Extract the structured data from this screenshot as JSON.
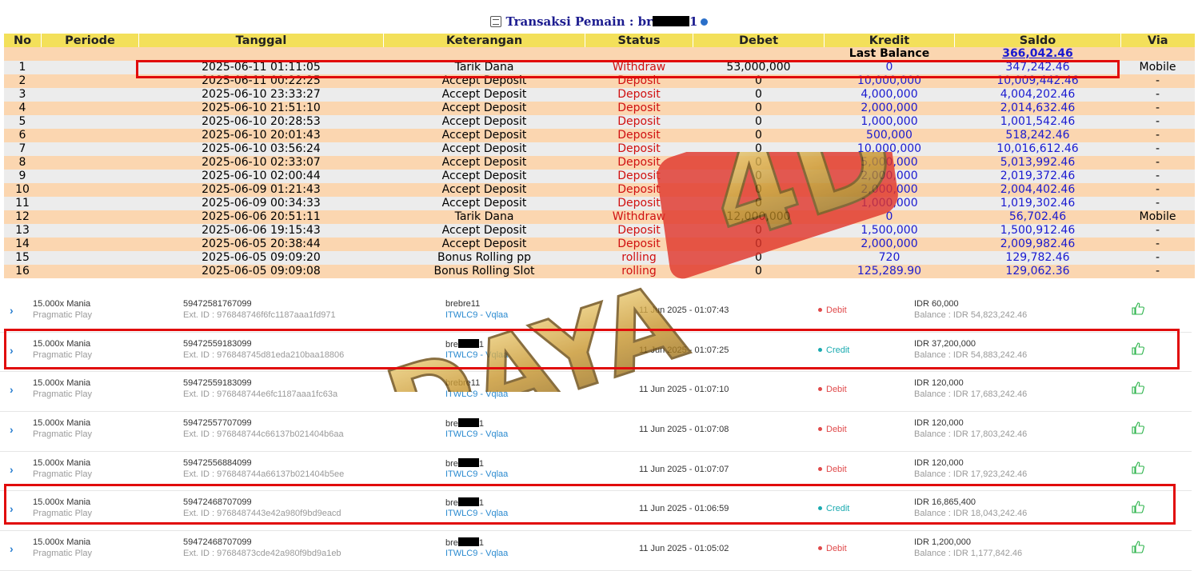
{
  "header": {
    "title_prefix": "Transaksi  Pemain : br",
    "title_suffix": "1"
  },
  "columns": [
    "No",
    "Periode",
    "Tanggal",
    "Keterangan",
    "Status",
    "Debet",
    "Kredit",
    "Saldo",
    "Via"
  ],
  "last_balance": {
    "label": "Last Balance",
    "value": "366,042.46"
  },
  "transactions": [
    {
      "no": "1",
      "tanggal": "2025-06-11 01:11:05",
      "ket": "Tarik Dana",
      "status": "Withdraw",
      "debet": "53,000,000",
      "kredit": "0",
      "saldo": "347,242.46",
      "via": "Mobile"
    },
    {
      "no": "2",
      "tanggal": "2025-06-11 00:22:25",
      "ket": "Accept Deposit",
      "status": "Deposit",
      "debet": "0",
      "kredit": "10,000,000",
      "saldo": "10,009,442.46",
      "via": "-"
    },
    {
      "no": "3",
      "tanggal": "2025-06-10 23:33:27",
      "ket": "Accept Deposit",
      "status": "Deposit",
      "debet": "0",
      "kredit": "4,000,000",
      "saldo": "4,004,202.46",
      "via": "-"
    },
    {
      "no": "4",
      "tanggal": "2025-06-10 21:51:10",
      "ket": "Accept Deposit",
      "status": "Deposit",
      "debet": "0",
      "kredit": "2,000,000",
      "saldo": "2,014,632.46",
      "via": "-"
    },
    {
      "no": "5",
      "tanggal": "2025-06-10 20:28:53",
      "ket": "Accept Deposit",
      "status": "Deposit",
      "debet": "0",
      "kredit": "1,000,000",
      "saldo": "1,001,542.46",
      "via": "-"
    },
    {
      "no": "6",
      "tanggal": "2025-06-10 20:01:43",
      "ket": "Accept Deposit",
      "status": "Deposit",
      "debet": "0",
      "kredit": "500,000",
      "saldo": "518,242.46",
      "via": "-"
    },
    {
      "no": "7",
      "tanggal": "2025-06-10 03:56:24",
      "ket": "Accept Deposit",
      "status": "Deposit",
      "debet": "0",
      "kredit": "10,000,000",
      "saldo": "10,016,612.46",
      "via": "-"
    },
    {
      "no": "8",
      "tanggal": "2025-06-10 02:33:07",
      "ket": "Accept Deposit",
      "status": "Deposit",
      "debet": "0",
      "kredit": "5,000,000",
      "saldo": "5,013,992.46",
      "via": "-"
    },
    {
      "no": "9",
      "tanggal": "2025-06-10 02:00:44",
      "ket": "Accept Deposit",
      "status": "Deposit",
      "debet": "0",
      "kredit": "2,000,000",
      "saldo": "2,019,372.46",
      "via": "-"
    },
    {
      "no": "10",
      "tanggal": "2025-06-09 01:21:43",
      "ket": "Accept Deposit",
      "status": "Deposit",
      "debet": "0",
      "kredit": "2,000,000",
      "saldo": "2,004,402.46",
      "via": "-"
    },
    {
      "no": "11",
      "tanggal": "2025-06-09 00:34:33",
      "ket": "Accept Deposit",
      "status": "Deposit",
      "debet": "0",
      "kredit": "1,000,000",
      "saldo": "1,019,302.46",
      "via": "-"
    },
    {
      "no": "12",
      "tanggal": "2025-06-06 20:51:11",
      "ket": "Tarik Dana",
      "status": "Withdraw",
      "debet": "12,000,000",
      "kredit": "0",
      "saldo": "56,702.46",
      "via": "Mobile"
    },
    {
      "no": "13",
      "tanggal": "2025-06-06 19:15:43",
      "ket": "Accept Deposit",
      "status": "Deposit",
      "debet": "0",
      "kredit": "1,500,000",
      "saldo": "1,500,912.46",
      "via": "-"
    },
    {
      "no": "14",
      "tanggal": "2025-06-05 20:38:44",
      "ket": "Accept Deposit",
      "status": "Deposit",
      "debet": "0",
      "kredit": "2,000,000",
      "saldo": "2,009,982.46",
      "via": "-"
    },
    {
      "no": "15",
      "tanggal": "2025-06-05 09:09:20",
      "ket": "Bonus Rolling pp",
      "status": "rolling",
      "debet": "0",
      "kredit": "720",
      "saldo": "129,782.46",
      "via": "-"
    },
    {
      "no": "16",
      "tanggal": "2025-06-05 09:09:08",
      "ket": "Bonus Rolling Slot",
      "status": "rolling",
      "debet": "0",
      "kredit": "125,289.90",
      "saldo": "129,062.36",
      "via": "-"
    }
  ],
  "bets": [
    {
      "game": "15.000x Mania",
      "provider": "Pragmatic Play",
      "id": "59472581767099",
      "ext": "Ext. ID : 976848746f6fc1187aaa1fd971",
      "user": "brebre11",
      "user_redacted": false,
      "site": "ITWLC9 - Vqlaa",
      "time": "11 Jun 2025 - 01:07:43",
      "type": "Debit",
      "amount": "IDR 60,000",
      "balance": "Balance : IDR 54,823,242.46"
    },
    {
      "game": "15.000x Mania",
      "provider": "Pragmatic Play",
      "id": "59472559183099",
      "ext": "Ext. ID : 976848745d81eda210baa18806",
      "user": "bre",
      "user_redacted": true,
      "site": "ITWLC9 - Vqlaa",
      "time": "11 Jun 2025 - 01:07:25",
      "type": "Credit",
      "amount": "IDR 37,200,000",
      "balance": "Balance : IDR 54,883,242.46"
    },
    {
      "game": "15.000x Mania",
      "provider": "Pragmatic Play",
      "id": "59472559183099",
      "ext": "Ext. ID : 976848744e6fc1187aaa1fc63a",
      "user": "brebre11",
      "user_redacted": false,
      "site": "ITWLC9 - Vqlaa",
      "time": "11 Jun 2025 - 01:07:10",
      "type": "Debit",
      "amount": "IDR 120,000",
      "balance": "Balance : IDR 17,683,242.46"
    },
    {
      "game": "15.000x Mania",
      "provider": "Pragmatic Play",
      "id": "59472557707099",
      "ext": "Ext. ID : 976848744c66137b021404b6aa",
      "user": "bre",
      "user_redacted": true,
      "site": "ITWLC9 - Vqlaa",
      "time": "11 Jun 2025 - 01:07:08",
      "type": "Debit",
      "amount": "IDR 120,000",
      "balance": "Balance : IDR 17,803,242.46"
    },
    {
      "game": "15.000x Mania",
      "provider": "Pragmatic Play",
      "id": "59472556884099",
      "ext": "Ext. ID : 976848744a66137b021404b5ee",
      "user": "bre",
      "user_redacted": true,
      "site": "ITWLC9 - Vqlaa",
      "time": "11 Jun 2025 - 01:07:07",
      "type": "Debit",
      "amount": "IDR 120,000",
      "balance": "Balance : IDR 17,923,242.46"
    },
    {
      "game": "15.000x Mania",
      "provider": "Pragmatic Play",
      "id": "59472468707099",
      "ext": "Ext. ID : 9768487443e42a980f9bd9eacd",
      "user": "bre",
      "user_redacted": true,
      "site": "ITWLC9 - Vqlaa",
      "time": "11 Jun 2025 - 01:06:59",
      "type": "Credit",
      "amount": "IDR 16,865,400",
      "balance": "Balance : IDR 18,043,242.46"
    },
    {
      "game": "15.000x Mania",
      "provider": "Pragmatic Play",
      "id": "59472468707099",
      "ext": "Ext. ID : 97684873cde42a980f9bd9a1eb",
      "user": "bre",
      "user_redacted": true,
      "site": "ITWLC9 - Vqlaa",
      "time": "11 Jun 2025 - 01:05:02",
      "type": "Debit",
      "amount": "IDR 1,200,000",
      "balance": "Balance : IDR 1,177,842.46"
    }
  ],
  "watermark": {
    "text": "DAYA 4D"
  },
  "colors": {
    "header_bg": "#f3e05a",
    "highlight": "#e10b0b",
    "saldo": "#1a1ad0"
  }
}
